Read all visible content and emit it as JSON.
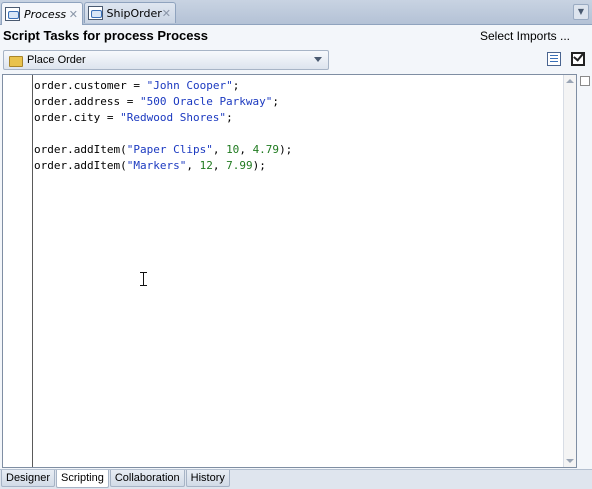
{
  "tabs": [
    {
      "label": "Process",
      "icon": "process-icon",
      "active": true
    },
    {
      "label": "ShipOrder",
      "icon": "process-icon",
      "active": false
    }
  ],
  "header": {
    "title": "Script Tasks for process Process",
    "select_imports": "Select Imports ..."
  },
  "task_select": {
    "value": "Place Order",
    "icon": "folder-icon"
  },
  "toolbar": {
    "icons": [
      "list-icon",
      "edit-icon"
    ]
  },
  "editor": {
    "lines": [
      [
        {
          "t": "plain",
          "v": "order.customer = "
        },
        {
          "t": "str",
          "v": "\"John Cooper\""
        },
        {
          "t": "plain",
          "v": ";"
        }
      ],
      [
        {
          "t": "plain",
          "v": "order.address = "
        },
        {
          "t": "str",
          "v": "\"500 Oracle Parkway\""
        },
        {
          "t": "plain",
          "v": ";"
        }
      ],
      [
        {
          "t": "plain",
          "v": "order.city = "
        },
        {
          "t": "str",
          "v": "\"Redwood Shores\""
        },
        {
          "t": "plain",
          "v": ";"
        }
      ],
      [],
      [
        {
          "t": "plain",
          "v": "order.addItem("
        },
        {
          "t": "str",
          "v": "\"Paper Clips\""
        },
        {
          "t": "plain",
          "v": ", "
        },
        {
          "t": "num",
          "v": "10"
        },
        {
          "t": "plain",
          "v": ", "
        },
        {
          "t": "num",
          "v": "4.79"
        },
        {
          "t": "plain",
          "v": ");"
        }
      ],
      [
        {
          "t": "plain",
          "v": "order.addItem("
        },
        {
          "t": "str",
          "v": "\"Markers\""
        },
        {
          "t": "plain",
          "v": ", "
        },
        {
          "t": "num",
          "v": "12"
        },
        {
          "t": "plain",
          "v": ", "
        },
        {
          "t": "num",
          "v": "7.99"
        },
        {
          "t": "plain",
          "v": ");"
        }
      ]
    ]
  },
  "bottom_tabs": [
    {
      "label": "Designer",
      "active": false
    },
    {
      "label": "Scripting",
      "active": true
    },
    {
      "label": "Collaboration",
      "active": false
    },
    {
      "label": "History",
      "active": false
    }
  ],
  "colors": {
    "string": "#1b39c0",
    "number": "#1f7a1f",
    "accent": "#3a70b8"
  }
}
